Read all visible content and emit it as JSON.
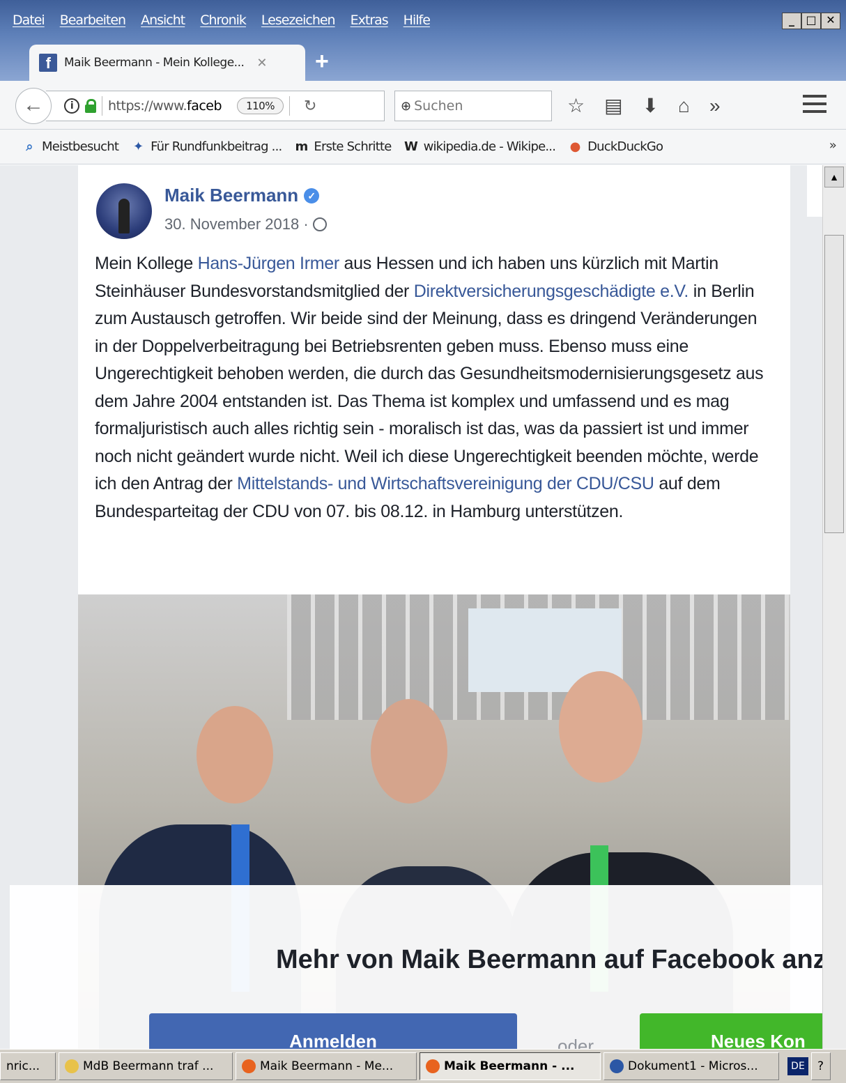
{
  "menu": {
    "items": [
      "Datei",
      "Bearbeiten",
      "Ansicht",
      "Chronik",
      "Lesezeichen",
      "Extras",
      "Hilfe"
    ]
  },
  "window_controls": {
    "minimize": "_",
    "maximize": "□",
    "close": "✕"
  },
  "tab": {
    "title": "Maik Beermann - Mein Kollege...",
    "close": "✕",
    "new_tab": "+"
  },
  "navbar": {
    "url_prefix": "https://www.",
    "url_host": "faceb",
    "zoom": "110%",
    "search_placeholder": "Suchen",
    "more": "»"
  },
  "bookmarks": {
    "items": [
      {
        "label": "Meistbesucht",
        "icon": "search-folder-icon",
        "glyph": "⌕",
        "color": "#3a78c8"
      },
      {
        "label": "Für Rundfunkbeitrag ...",
        "icon": "globe-grid-icon",
        "glyph": "✦",
        "color": "#2b57a5"
      },
      {
        "label": "Erste Schritte",
        "icon": "m-logo-icon",
        "glyph": "m",
        "color": "#222222"
      },
      {
        "label": "wikipedia.de - Wikipe...",
        "icon": "wikipedia-icon",
        "glyph": "W",
        "color": "#222222"
      },
      {
        "label": "DuckDuckGo",
        "icon": "duckduckgo-icon",
        "glyph": "●",
        "color": "#de5833"
      }
    ],
    "more": "»"
  },
  "post": {
    "author": "Maik Beermann",
    "date": "30. November 2018 ·",
    "text": {
      "p1": "Mein Kollege ",
      "link1": "Hans-Jürgen Irmer",
      "p2": " aus Hessen und ich haben uns kürzlich mit Martin Steinhäuser Bundesvorstandsmitglied der ",
      "link2": "Direktversicherungsgeschädigte e.V.",
      "p3": " in Berlin zum Austausch getroffen. Wir beide sind der Meinung, dass es dringend Veränderungen in der Doppelverbeitragung bei Betriebsrenten geben muss. Ebenso muss eine Ungerechtigkeit behoben werden, die durch das Gesundheitsmodernisierungsgesetz aus dem Jahre 2004 entstanden ist. Das Thema ist komplex und umfassend und es mag formaljuristisch auch alles richtig sein - moralisch ist das, was da passiert ist und immer noch nicht geändert wurde nicht. Weil ich diese Ungerechtigkeit beenden möchte, werde ich den Antrag der ",
      "link3": "Mittelstands- und Wirtschaftsvereinigung der CDU/CSU",
      "p4": " auf dem Bundesparteitag der CDU von 07. bis 08.12. in Hamburg unterstützen."
    }
  },
  "overlay": {
    "title": "Mehr von Maik Beermann auf Facebook anze",
    "login_label": "Anmelden",
    "or_label": "oder",
    "signup_label": "Neues Kon"
  },
  "taskbar": {
    "items": [
      {
        "label": "nric...",
        "active": false,
        "icon_color": "#ffffff"
      },
      {
        "label": "MdB Beermann traf ...",
        "active": false,
        "icon_color": "#e8c24a"
      },
      {
        "label": "Maik Beermann - Me...",
        "active": false,
        "icon_color": "#e8631f"
      },
      {
        "label": "Maik Beermann - ...",
        "active": true,
        "icon_color": "#e8631f"
      },
      {
        "label": "Dokument1 - Micros...",
        "active": false,
        "icon_color": "#2b57a5"
      }
    ],
    "lang": "DE",
    "help": "?"
  }
}
